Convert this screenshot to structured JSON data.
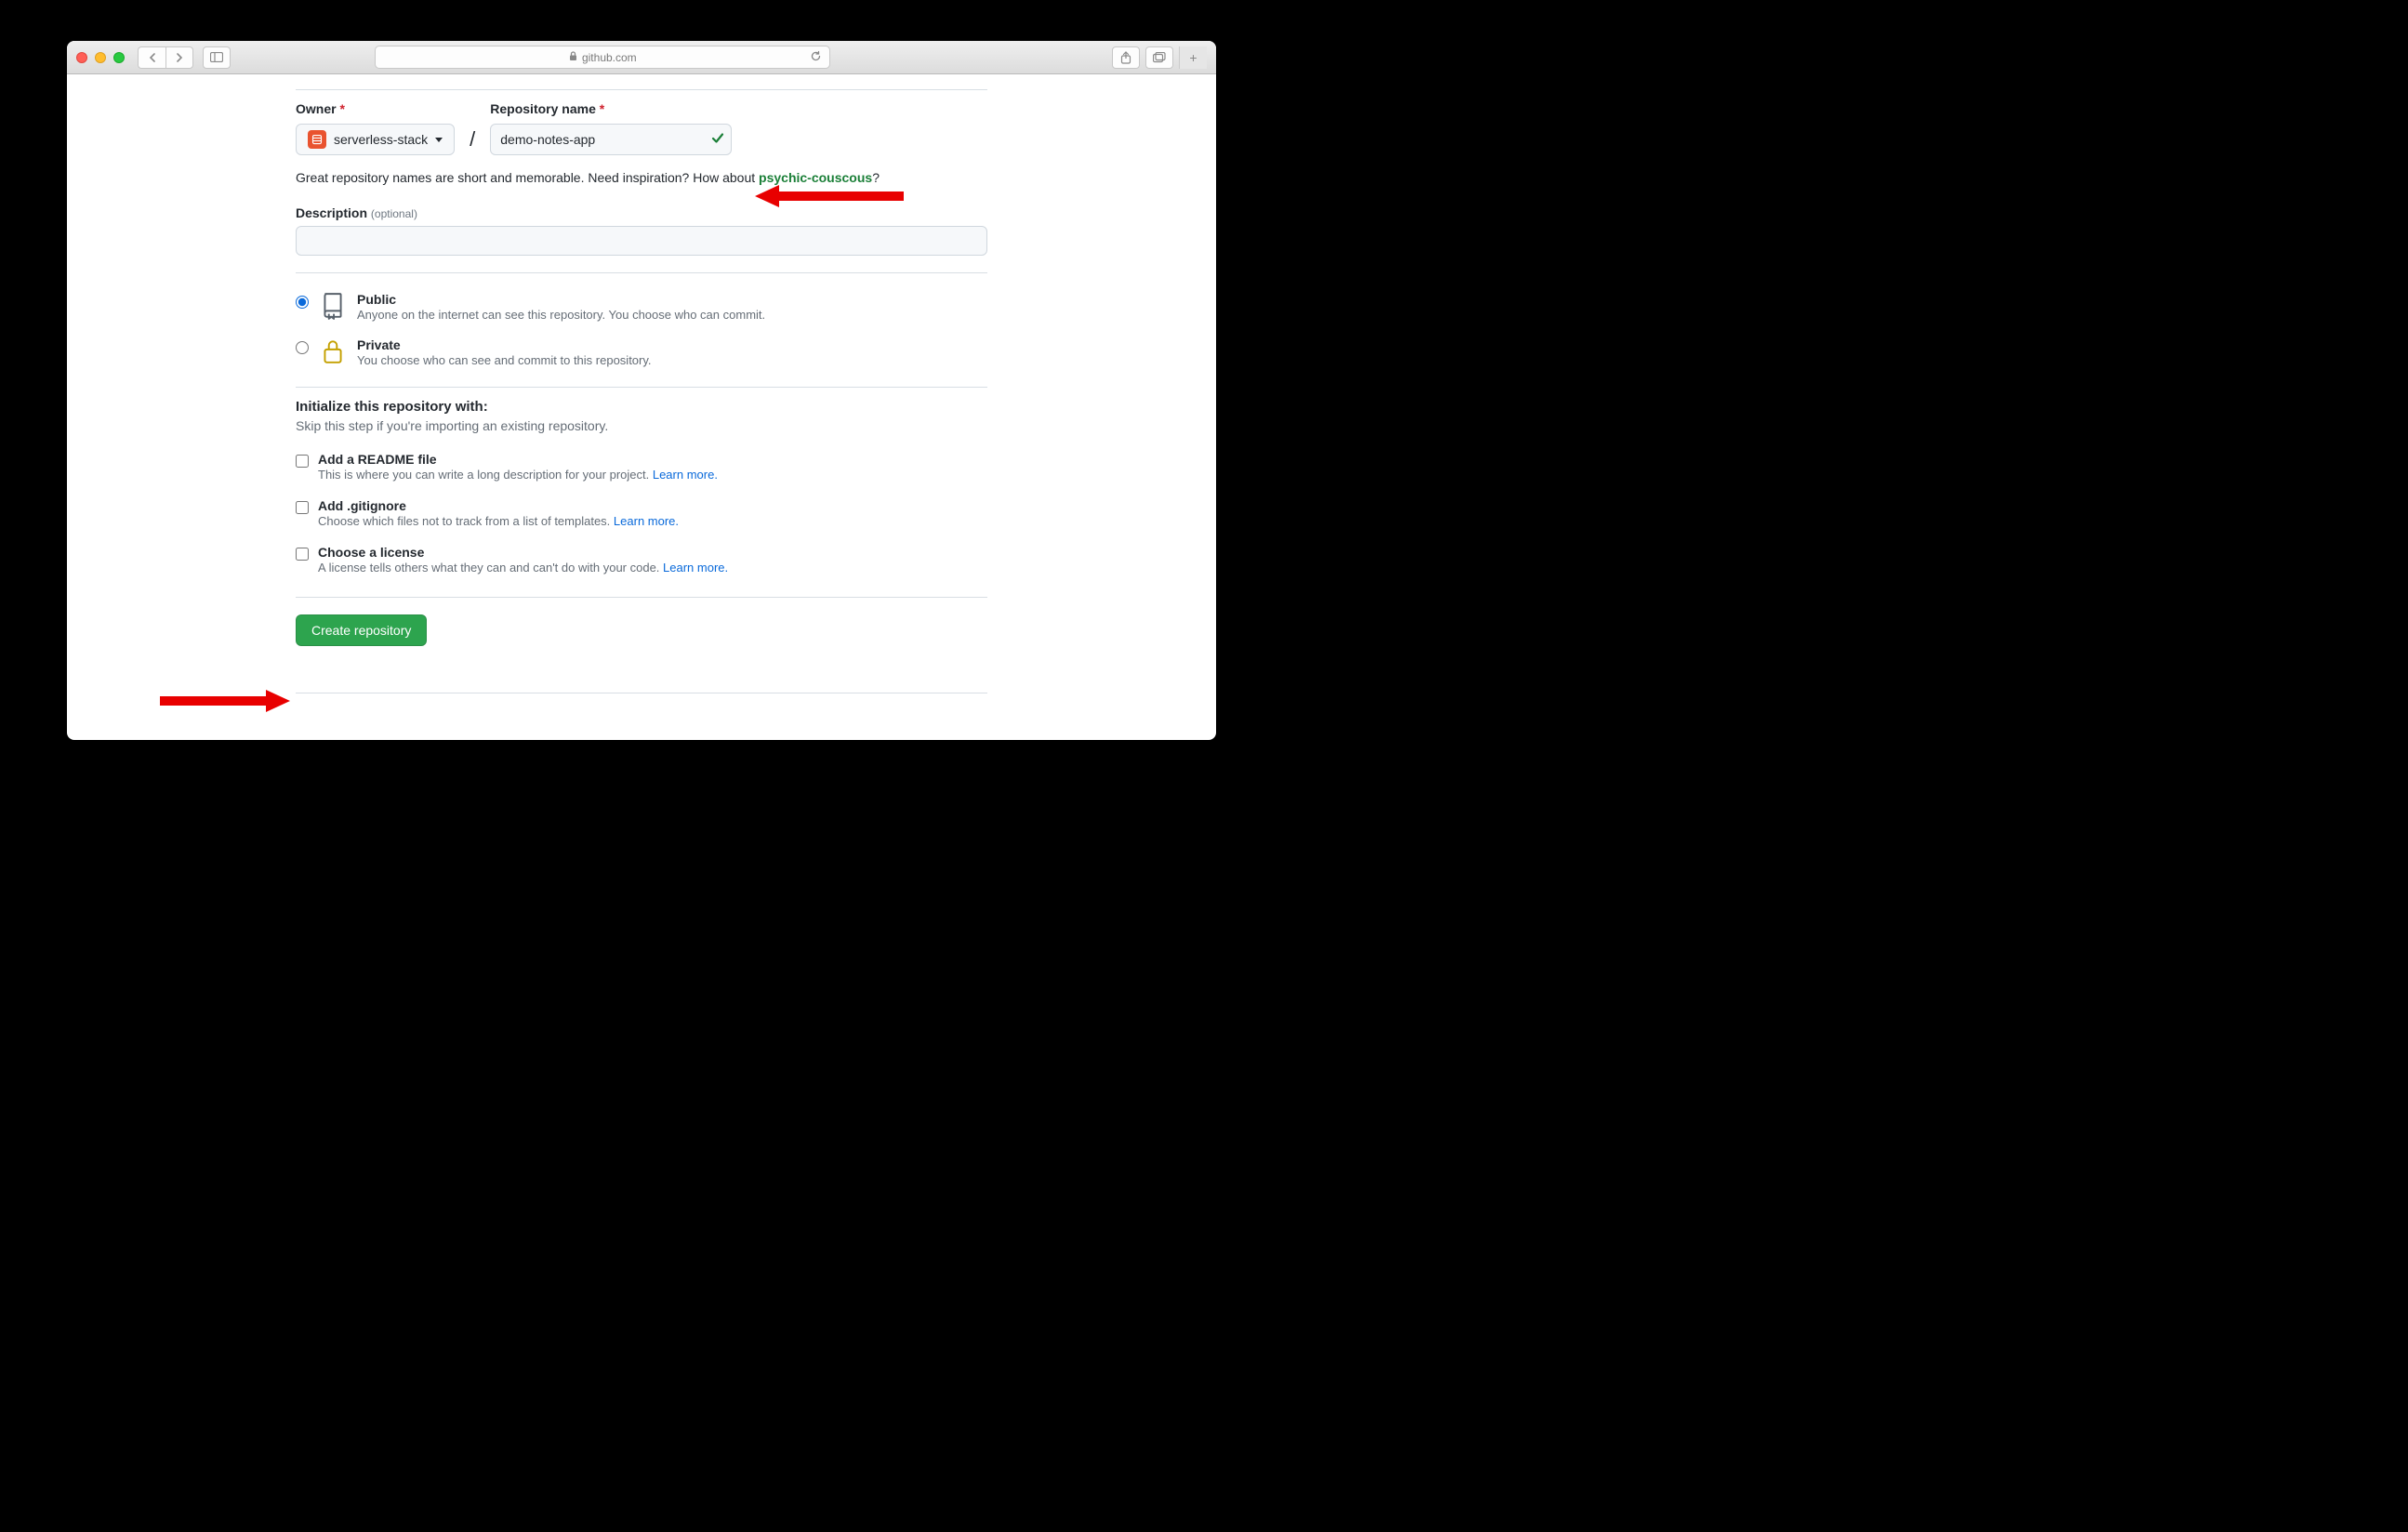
{
  "browser": {
    "domain": "github.com"
  },
  "form": {
    "owner_label": "Owner",
    "owner_value": "serverless-stack",
    "repo_label": "Repository name",
    "repo_value": "demo-notes-app",
    "hint_prefix": "Great repository names are short and memorable. Need inspiration? How about ",
    "hint_suggestion": "psychic-couscous",
    "hint_suffix": "?",
    "description_label": "Description",
    "description_optional": "(optional)",
    "description_value": "",
    "visibility": {
      "public": {
        "title": "Public",
        "desc": "Anyone on the internet can see this repository. You choose who can commit."
      },
      "private": {
        "title": "Private",
        "desc": "You choose who can see and commit to this repository."
      }
    },
    "init": {
      "heading": "Initialize this repository with:",
      "sub": "Skip this step if you're importing an existing repository.",
      "readme": {
        "title": "Add a README file",
        "desc": "This is where you can write a long description for your project. "
      },
      "gitignore": {
        "title": "Add .gitignore",
        "desc": "Choose which files not to track from a list of templates. "
      },
      "license": {
        "title": "Choose a license",
        "desc": "A license tells others what they can and can't do with your code. "
      },
      "learn_more": "Learn more."
    },
    "submit": "Create repository"
  }
}
